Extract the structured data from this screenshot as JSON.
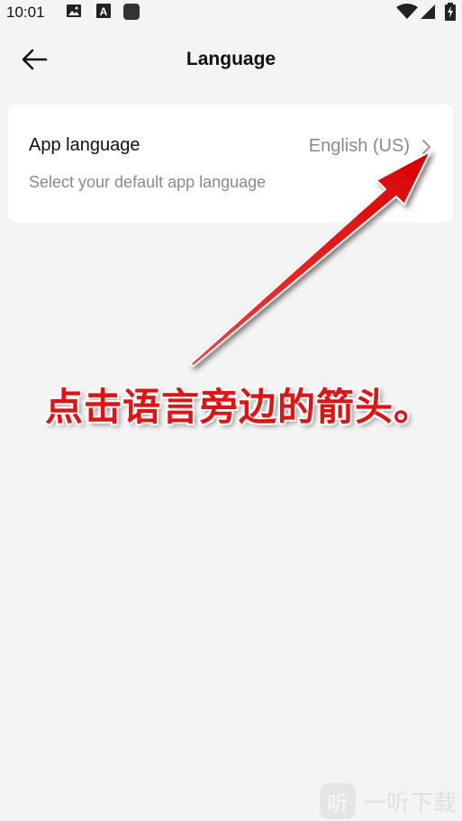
{
  "status_bar": {
    "time": "10:01",
    "icons": [
      "gallery-icon",
      "font-icon",
      "square-icon",
      "wifi-icon",
      "signal-icon",
      "battery-charging-icon"
    ]
  },
  "header": {
    "title": "Language",
    "back_icon": "arrow-left-icon"
  },
  "setting": {
    "title": "App language",
    "subtitle": "Select your default app language",
    "value": "English (US)",
    "chevron_icon": "chevron-right-icon"
  },
  "annotation": {
    "caption": "点击语言旁边的箭头。",
    "color": "#e80f0f"
  },
  "watermark": {
    "logo_text": "听",
    "text": "一听下载"
  }
}
